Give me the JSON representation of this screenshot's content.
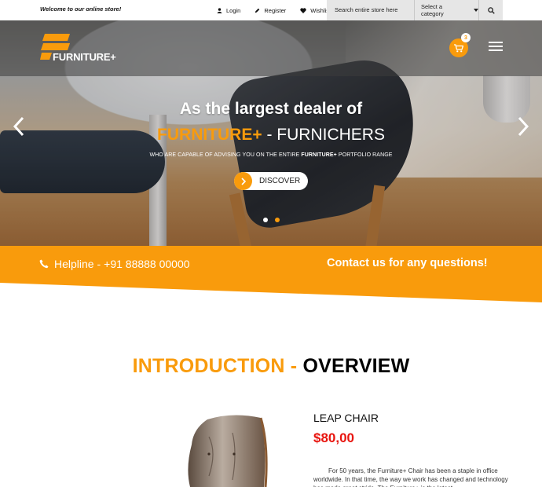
{
  "topbar": {
    "welcome": "Welcome to our online store!",
    "links": [
      {
        "label": "Login",
        "icon": "user-icon"
      },
      {
        "label": "Register",
        "icon": "pencil-icon"
      },
      {
        "label": "Wishlist",
        "icon": "heart-icon"
      }
    ],
    "search_placeholder": "Search entire store here",
    "category_selected": "Select a category",
    "search_button_icon": "search-icon"
  },
  "header": {
    "logo_text": "FURNITURE+",
    "cart_count": "3",
    "cart_icon": "cart-icon",
    "menu_icon": "hamburger-icon"
  },
  "hero": {
    "title": "As the largest dealer of",
    "subtitle_brand": "FURNITURE+",
    "subtitle_rest": " - FURNICHERS",
    "tagline_pre": "WHO ARE CAPABLE OF ADVISING YOU ON THE ENTIRE ",
    "tagline_brand": "FURNITURE+",
    "tagline_post": " PORTFOLIO RANGE",
    "cta_label": "DISCOVER",
    "slides_total": 2,
    "active_slide": 2
  },
  "band": {
    "helpline_label": "Helpline -",
    "helpline_number": "+91 88888 00000",
    "contact_text": "Contact us for any questions!"
  },
  "intro": {
    "heading_orange": "INTRODUCTION -",
    "heading_black": "OVERVIEW"
  },
  "product": {
    "name": "LEAP CHAIR",
    "price": "$80,00",
    "description": "For 50 years, the Furniture+ Chair has been a staple in office worldwide. In that time, the way we work has changed and technology has made great stride. The Furniture+ is the latest"
  },
  "colors": {
    "accent": "#f99b0c",
    "price": "#e8140e"
  }
}
